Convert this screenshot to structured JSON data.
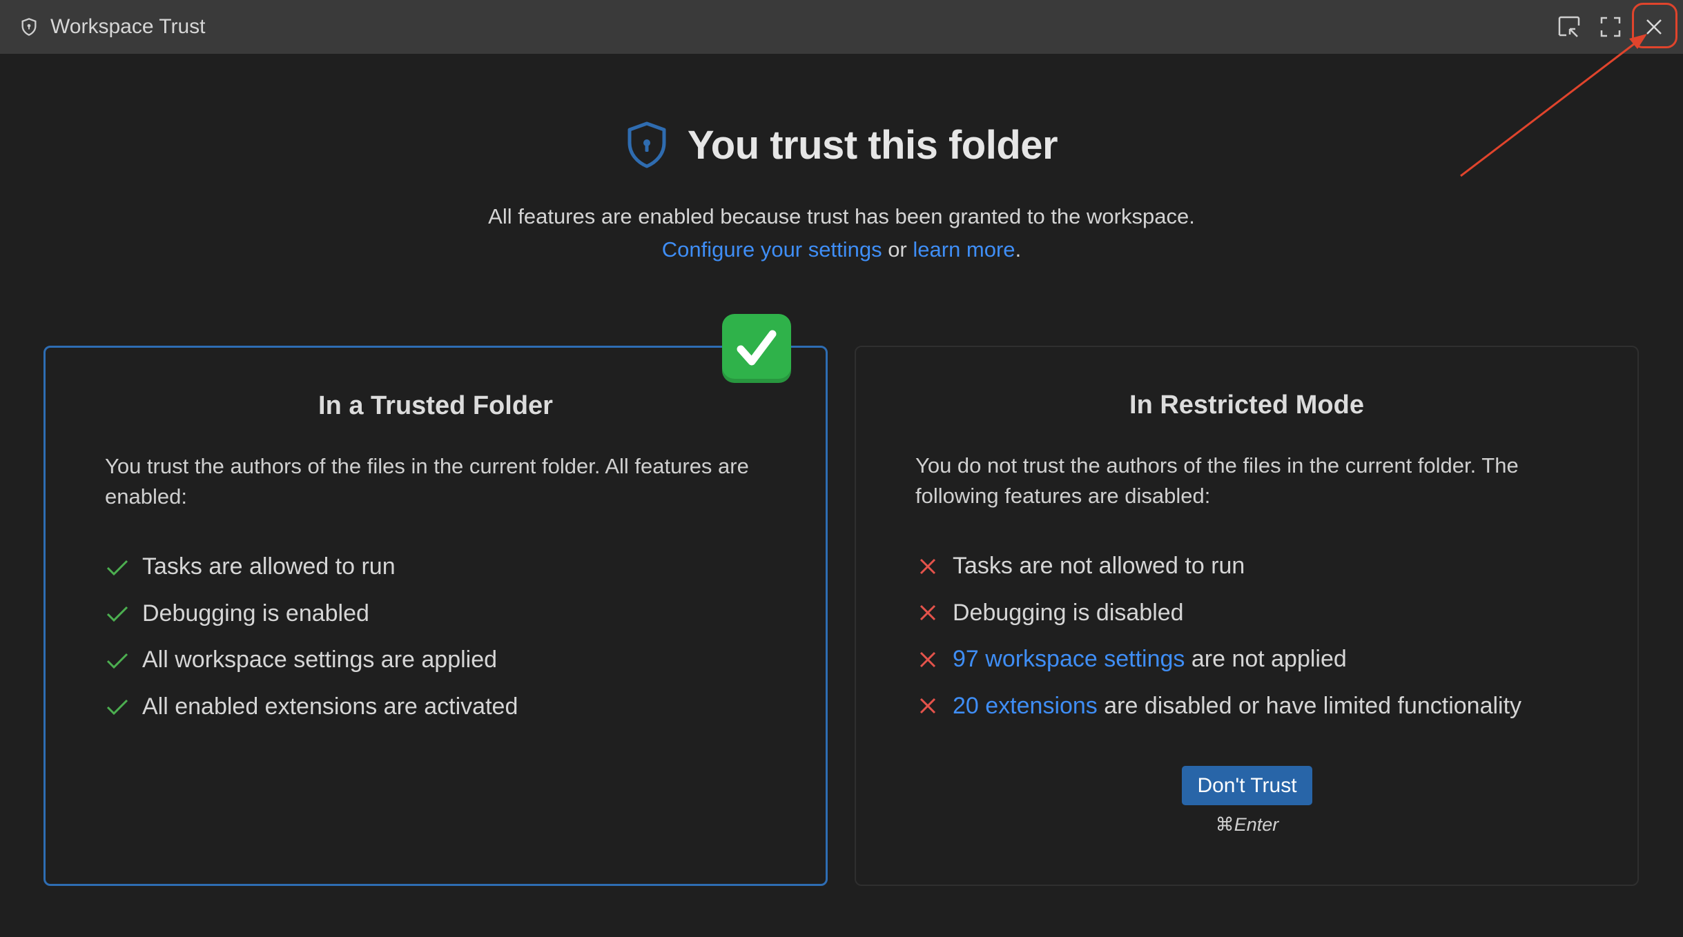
{
  "titlebar": {
    "title": "Workspace Trust",
    "icons": [
      "shield-icon",
      "popout-icon",
      "maximize-icon",
      "close-icon"
    ]
  },
  "hero": {
    "title": "You trust this folder",
    "description": "All features are enabled because trust has been granted to the workspace.",
    "configure_link": "Configure your settings",
    "or_text": " or ",
    "learn_more_link": "learn more",
    "period": "."
  },
  "trusted_card": {
    "title": "In a Trusted Folder",
    "description": "You trust the authors of the files in the current folder. All features are enabled:",
    "items": [
      "Tasks are allowed to run",
      "Debugging is enabled",
      "All workspace settings are applied",
      "All enabled extensions are activated"
    ],
    "badge_icon": "check-mark-button-icon"
  },
  "restricted_card": {
    "title": "In Restricted Mode",
    "description": "You do not trust the authors of the files in the current folder. The following features are disabled:",
    "item1": "Tasks are not allowed to run",
    "item2": "Debugging is disabled",
    "item3_link": "97 workspace settings",
    "item3_rest": " are not applied",
    "item4_link": "20 extensions",
    "item4_rest": " are disabled or have limited functionality",
    "button_label": "Don't Trust",
    "shortcut": "⌘Enter"
  },
  "colors": {
    "background": "#1f1f1f",
    "titlebar": "#3a3a3a",
    "link": "#3f8ef6",
    "trusted_border": "#2e6db3",
    "check": "#4caf50",
    "cross": "#e5534b",
    "button": "#2865a8",
    "annotation": "#e0442c"
  }
}
